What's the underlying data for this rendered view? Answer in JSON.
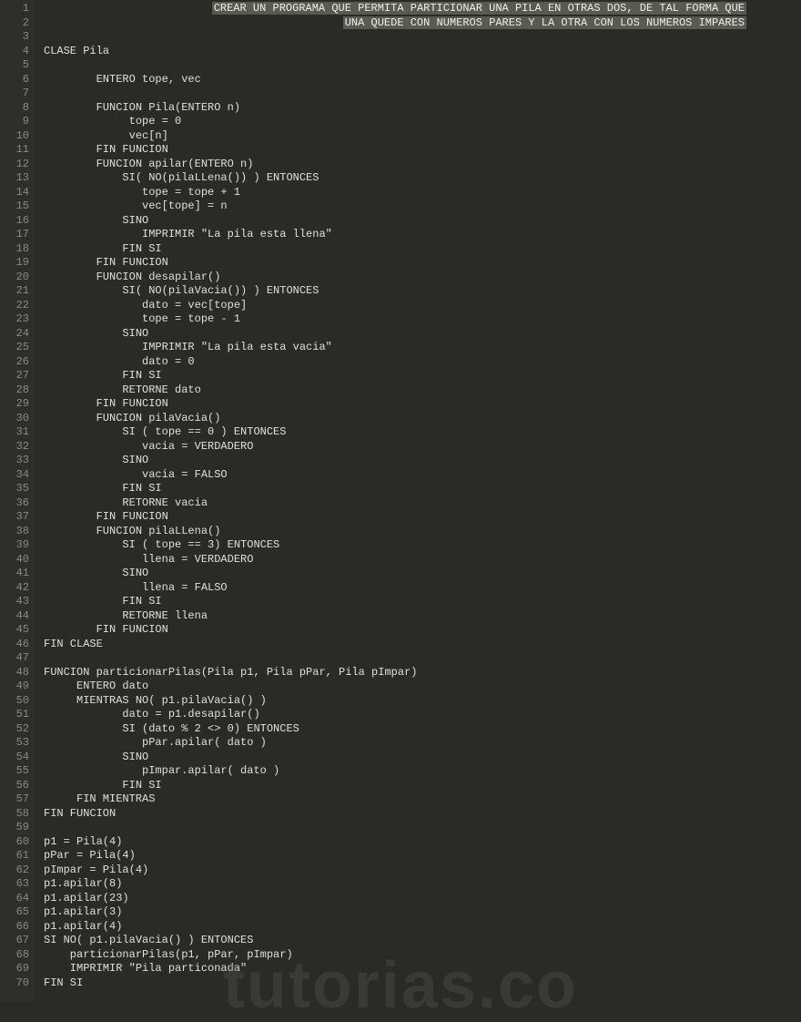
{
  "banner_line1": "CREAR UN PROGRAMA QUE PERMITA PARTICIONAR UNA PILA EN OTRAS DOS, DE TAL FORMA QUE",
  "banner_line2": "UNA QUEDE CON NUMEROS PARES Y LA OTRA CON LOS NUMEROS IMPARES",
  "watermark": "tutorias.co",
  "lines": [
    {
      "n": 1,
      "banner": 1
    },
    {
      "n": 2,
      "banner": 2
    },
    {
      "n": 3,
      "t": ""
    },
    {
      "n": 4,
      "t": "CLASE Pila"
    },
    {
      "n": 5,
      "t": ""
    },
    {
      "n": 6,
      "t": "        ENTERO tope, vec"
    },
    {
      "n": 7,
      "t": ""
    },
    {
      "n": 8,
      "t": "        FUNCION Pila(ENTERO n)"
    },
    {
      "n": 9,
      "t": "             tope = 0"
    },
    {
      "n": 10,
      "t": "             vec[n]"
    },
    {
      "n": 11,
      "t": "        FIN FUNCION"
    },
    {
      "n": 12,
      "t": "        FUNCION apilar(ENTERO n)"
    },
    {
      "n": 13,
      "t": "            SI( NO(pilaLLena()) ) ENTONCES"
    },
    {
      "n": 14,
      "t": "               tope = tope + 1"
    },
    {
      "n": 15,
      "t": "               vec[tope] = n"
    },
    {
      "n": 16,
      "t": "            SINO"
    },
    {
      "n": 17,
      "t": "               IMPRIMIR \"La pila esta llena\""
    },
    {
      "n": 18,
      "t": "            FIN SI"
    },
    {
      "n": 19,
      "t": "        FIN FUNCION"
    },
    {
      "n": 20,
      "t": "        FUNCION desapilar()"
    },
    {
      "n": 21,
      "t": "            SI( NO(pilaVacia()) ) ENTONCES"
    },
    {
      "n": 22,
      "t": "               dato = vec[tope]"
    },
    {
      "n": 23,
      "t": "               tope = tope - 1"
    },
    {
      "n": 24,
      "t": "            SINO"
    },
    {
      "n": 25,
      "t": "               IMPRIMIR \"La pila esta vacia\""
    },
    {
      "n": 26,
      "t": "               dato = 0"
    },
    {
      "n": 27,
      "t": "            FIN SI"
    },
    {
      "n": 28,
      "t": "            RETORNE dato"
    },
    {
      "n": 29,
      "t": "        FIN FUNCION"
    },
    {
      "n": 30,
      "t": "        FUNCION pilaVacia()"
    },
    {
      "n": 31,
      "t": "            SI ( tope == 0 ) ENTONCES"
    },
    {
      "n": 32,
      "t": "               vacia = VERDADERO"
    },
    {
      "n": 33,
      "t": "            SINO"
    },
    {
      "n": 34,
      "t": "               vacia = FALSO"
    },
    {
      "n": 35,
      "t": "            FIN SI"
    },
    {
      "n": 36,
      "t": "            RETORNE vacia"
    },
    {
      "n": 37,
      "t": "        FIN FUNCION"
    },
    {
      "n": 38,
      "t": "        FUNCION pilaLLena()"
    },
    {
      "n": 39,
      "t": "            SI ( tope == 3) ENTONCES"
    },
    {
      "n": 40,
      "t": "               llena = VERDADERO"
    },
    {
      "n": 41,
      "t": "            SINO"
    },
    {
      "n": 42,
      "t": "               llena = FALSO"
    },
    {
      "n": 43,
      "t": "            FIN SI"
    },
    {
      "n": 44,
      "t": "            RETORNE llena"
    },
    {
      "n": 45,
      "t": "        FIN FUNCION"
    },
    {
      "n": 46,
      "t": "FIN CLASE"
    },
    {
      "n": 47,
      "t": ""
    },
    {
      "n": 48,
      "t": "FUNCION particionarPilas(Pila p1, Pila pPar, Pila pImpar)"
    },
    {
      "n": 49,
      "t": "     ENTERO dato"
    },
    {
      "n": 50,
      "t": "     MIENTRAS NO( p1.pilaVacia() )"
    },
    {
      "n": 51,
      "t": "            dato = p1.desapilar()"
    },
    {
      "n": 52,
      "t": "            SI (dato % 2 <> 0) ENTONCES"
    },
    {
      "n": 53,
      "t": "               pPar.apilar( dato )"
    },
    {
      "n": 54,
      "t": "            SINO"
    },
    {
      "n": 55,
      "t": "               pImpar.apilar( dato )"
    },
    {
      "n": 56,
      "t": "            FIN SI"
    },
    {
      "n": 57,
      "t": "     FIN MIENTRAS"
    },
    {
      "n": 58,
      "t": "FIN FUNCION"
    },
    {
      "n": 59,
      "t": ""
    },
    {
      "n": 60,
      "t": "p1 = Pila(4)"
    },
    {
      "n": 61,
      "t": "pPar = Pila(4)"
    },
    {
      "n": 62,
      "t": "pImpar = Pila(4)"
    },
    {
      "n": 63,
      "t": "p1.apilar(8)"
    },
    {
      "n": 64,
      "t": "p1.apilar(23)"
    },
    {
      "n": 65,
      "t": "p1.apilar(3)"
    },
    {
      "n": 66,
      "t": "p1.apilar(4)"
    },
    {
      "n": 67,
      "t": "SI NO( p1.pilaVacia() ) ENTONCES"
    },
    {
      "n": 68,
      "t": "    particionarPilas(p1, pPar, pImpar)"
    },
    {
      "n": 69,
      "t": "    IMPRIMIR \"Pila particonada\""
    },
    {
      "n": 70,
      "t": "FIN SI"
    }
  ]
}
